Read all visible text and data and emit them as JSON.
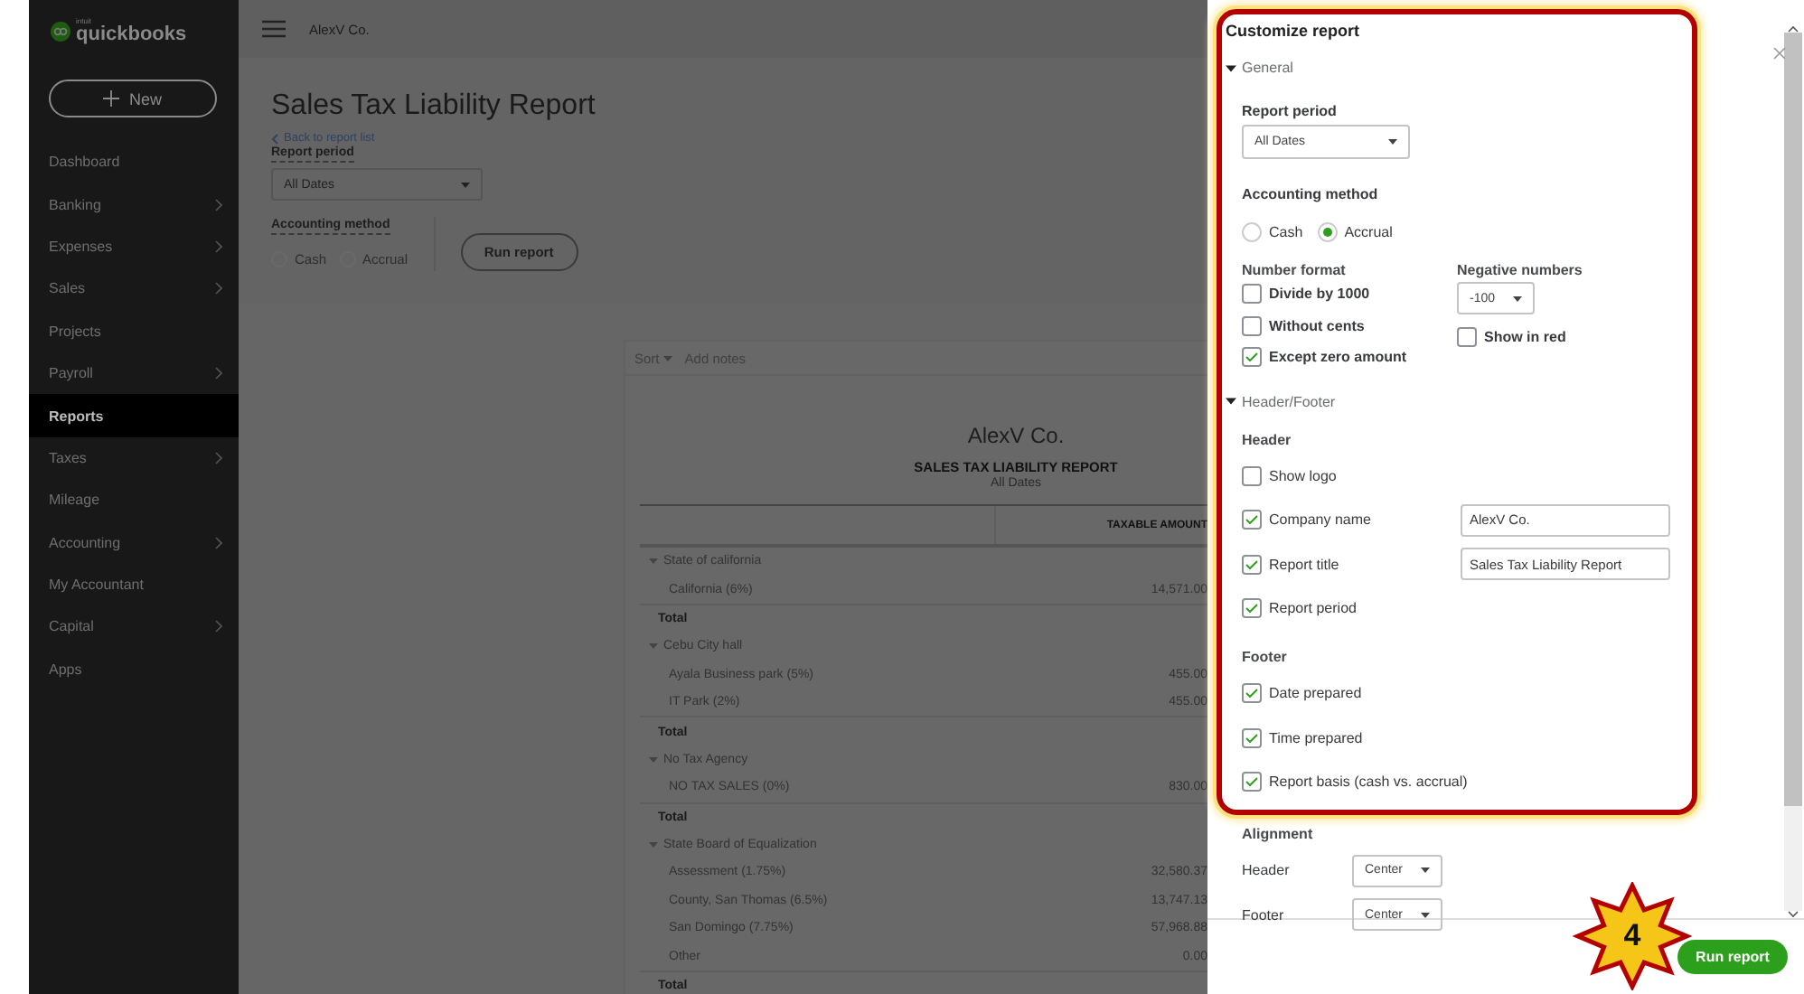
{
  "app": {
    "logo_tagline": "intuit",
    "logo_name": "quickbooks",
    "new_button": "New",
    "company": "AlexV Co."
  },
  "sidebar": {
    "items": [
      {
        "label": "Dashboard",
        "selected": false,
        "has_submenu": false
      },
      {
        "label": "Banking",
        "selected": false,
        "has_submenu": true
      },
      {
        "label": "Expenses",
        "selected": false,
        "has_submenu": true
      },
      {
        "label": "Sales",
        "selected": false,
        "has_submenu": true
      },
      {
        "label": "Projects",
        "selected": false,
        "has_submenu": false
      },
      {
        "label": "Payroll",
        "selected": false,
        "has_submenu": true
      },
      {
        "label": "Reports",
        "selected": true,
        "has_submenu": false
      },
      {
        "label": "Taxes",
        "selected": false,
        "has_submenu": true
      },
      {
        "label": "Mileage",
        "selected": false,
        "has_submenu": false
      },
      {
        "label": "Accounting",
        "selected": false,
        "has_submenu": true
      },
      {
        "label": "My Accountant",
        "selected": false,
        "has_submenu": false
      },
      {
        "label": "Capital",
        "selected": false,
        "has_submenu": true
      },
      {
        "label": "Apps",
        "selected": false,
        "has_submenu": false
      }
    ]
  },
  "page": {
    "title": "Sales Tax Liability Report",
    "back_link": "Back to report list",
    "report_period_label": "Report period",
    "report_period": "All Dates",
    "accounting_method_label": "Accounting method",
    "methods": [
      {
        "label": "Cash",
        "selected": false
      },
      {
        "label": "Accrual",
        "selected": false
      }
    ],
    "run_button": "Run report"
  },
  "report": {
    "toolbar": [
      "Sort",
      "Add notes"
    ],
    "company": "AlexV Co.",
    "title": "SALES TAX LIABILITY REPORT",
    "period": "All Dates",
    "columns": [
      "TAXABLE AMOUNT"
    ],
    "groups": [
      {
        "name": "State of california",
        "expanded": true,
        "children": [
          {
            "name": "California (6%)",
            "amount": "14,571.00"
          }
        ],
        "total": "Total"
      },
      {
        "name": "Cebu City hall",
        "expanded": true,
        "children": [
          {
            "name": "Ayala Business park (5%)",
            "amount": "455.00"
          },
          {
            "name": "IT Park (2%)",
            "amount": "455.00"
          }
        ],
        "total": "Total"
      },
      {
        "name": "No Tax Agency",
        "expanded": true,
        "children": [
          {
            "name": "NO TAX SALES (0%)",
            "amount": "830.00"
          }
        ],
        "total": "Total"
      },
      {
        "name": "State Board of Equalization",
        "expanded": true,
        "children": [
          {
            "name": "Assessment (1.75%)",
            "amount": "32,580.37"
          },
          {
            "name": "County, San Thomas (6.5%)",
            "amount": "13,747.13"
          },
          {
            "name": "San Domingo (7.75%)",
            "amount": "57,968.88"
          },
          {
            "name": "Other",
            "amount": "0.00"
          }
        ],
        "total": "Total"
      }
    ]
  },
  "customize": {
    "title": "Customize report",
    "general": {
      "title": "General",
      "expanded": true,
      "report_period_label": "Report period",
      "report_period": "All Dates",
      "accounting_method_label": "Accounting method",
      "methods": [
        {
          "label": "Cash",
          "selected": false
        },
        {
          "label": "Accrual",
          "selected": true
        }
      ],
      "number_format_label": "Number format",
      "number_options": [
        {
          "label": "Divide by 1000",
          "checked": false
        },
        {
          "label": "Without cents",
          "checked": false
        },
        {
          "label": "Except zero amount",
          "checked": true
        }
      ],
      "negative_label": "Negative numbers",
      "negative_value": "-100",
      "show_in_red": {
        "label": "Show in red",
        "checked": false
      }
    },
    "header_footer": {
      "title": "Header/Footer",
      "expanded": true,
      "header_label": "Header",
      "header_items": [
        {
          "label": "Show logo",
          "checked": false
        },
        {
          "label": "Company name",
          "checked": true,
          "value": "AlexV Co."
        },
        {
          "label": "Report title",
          "checked": true,
          "value": "Sales Tax Liability Report"
        },
        {
          "label": "Report period",
          "checked": true
        }
      ],
      "footer_label": "Footer",
      "footer_items": [
        {
          "label": "Date prepared",
          "checked": true
        },
        {
          "label": "Time prepared",
          "checked": true
        },
        {
          "label": "Report basis (cash vs. accrual)",
          "checked": true
        }
      ]
    },
    "alignment": {
      "label": "Alignment",
      "rows": [
        {
          "label": "Header",
          "value": "Center"
        },
        {
          "label": "Footer",
          "value": "Center"
        }
      ]
    },
    "run_button": "Run report"
  },
  "callout": {
    "number": "4"
  }
}
